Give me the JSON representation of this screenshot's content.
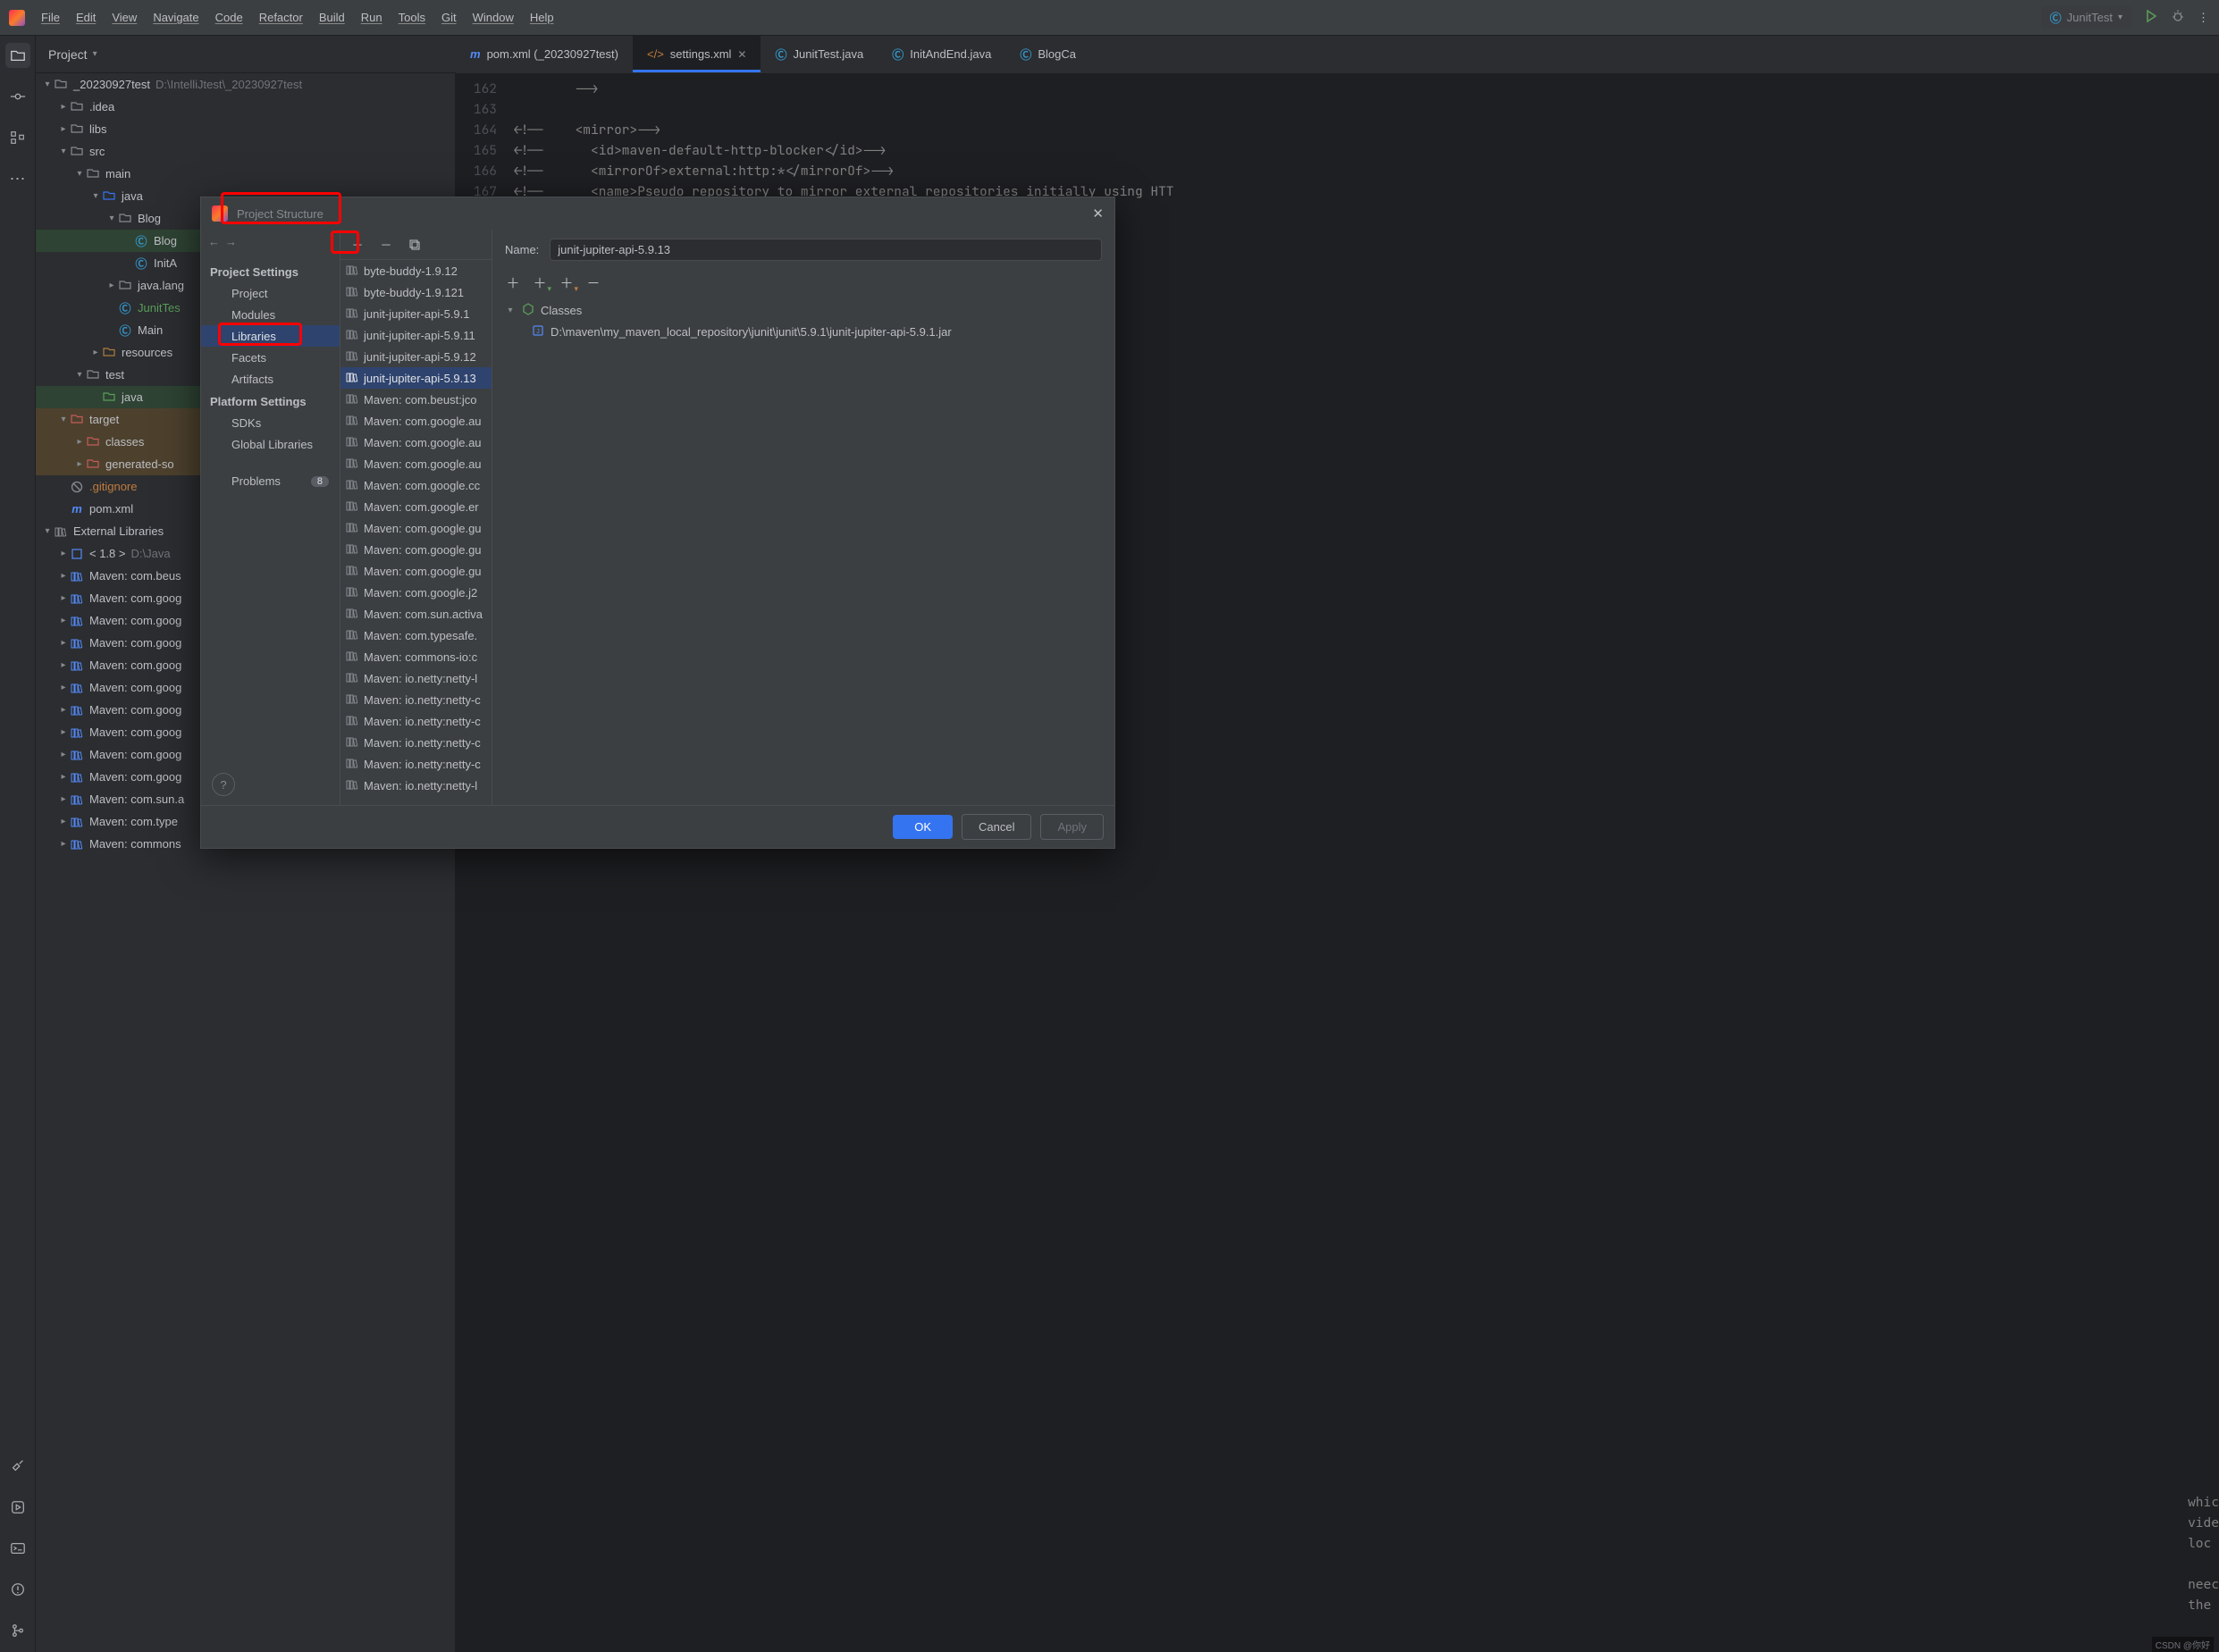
{
  "menubar": [
    "File",
    "Edit",
    "View",
    "Navigate",
    "Code",
    "Refactor",
    "Build",
    "Run",
    "Tools",
    "Git",
    "Window",
    "Help"
  ],
  "runConfig": "JunitTest",
  "projectHeader": "Project",
  "tree": {
    "root": "_20230927test",
    "rootPath": "D:\\IntelliJtest\\_20230927test",
    "idea": ".idea",
    "libs": "libs",
    "src": "src",
    "main": "main",
    "java_main": "java",
    "blog": "Blog",
    "blogfile": "Blog",
    "initfile": "InitA",
    "javalang": "java.lang",
    "junittest": "JunitTes",
    "mainclass": "Main",
    "resources": "resources",
    "test": "test",
    "java_test": "java",
    "target": "target",
    "classes": "classes",
    "generated": "generated-so",
    "gitignore": ".gitignore",
    "pomxml": "pom.xml",
    "external": "External Libraries",
    "jdk": "< 1.8 >",
    "jdkPath": "D:\\Java",
    "maven_libs": [
      "Maven: com.beus",
      "Maven: com.goog",
      "Maven: com.goog",
      "Maven: com.goog",
      "Maven: com.goog",
      "Maven: com.goog",
      "Maven: com.goog",
      "Maven: com.goog",
      "Maven: com.goog",
      "Maven: com.goog",
      "Maven: com.sun.a",
      "Maven: com.type",
      "Maven: commons"
    ]
  },
  "tabs": [
    {
      "icon": "m",
      "label": "pom.xml (_20230927test)",
      "active": false,
      "close": false
    },
    {
      "icon": "code",
      "label": "settings.xml",
      "active": true,
      "close": true
    },
    {
      "icon": "c",
      "label": "JunitTest.java",
      "active": false,
      "close": false
    },
    {
      "icon": "c",
      "label": "InitAndEnd.java",
      "active": false,
      "close": false
    },
    {
      "icon": "c",
      "label": "BlogCa",
      "active": false,
      "close": false
    }
  ],
  "code": [
    {
      "n": "162",
      "t": "        -->"
    },
    {
      "n": "163",
      "t": ""
    },
    {
      "n": "164",
      "t": "<!--    <mirror>-->"
    },
    {
      "n": "165",
      "t": "<!--      <id>maven-default-http-blocker</id>-->"
    },
    {
      "n": "166",
      "t": "<!--      <mirrorOf>external:http:*</mirrorOf>-->"
    },
    {
      "n": "167",
      "t": "<!--      <name>Pseudo repository to mirror external repositories initially using HTT"
    }
  ],
  "codeBg": [
    "whic",
    "vide",
    "loc",
    "",
    "neec",
    "the"
  ],
  "modal": {
    "title": "Project Structure",
    "sections": {
      "projectSettings": "Project Settings",
      "platformSettings": "Platform Settings"
    },
    "nav": {
      "project": "Project",
      "modules": "Modules",
      "libraries": "Libraries",
      "facets": "Facets",
      "artifacts": "Artifacts",
      "sdks": "SDKs",
      "globalLibraries": "Global Libraries",
      "problems": "Problems"
    },
    "problemsCount": "8",
    "libList": [
      "byte-buddy-1.9.12",
      "byte-buddy-1.9.121",
      "junit-jupiter-api-5.9.1",
      "junit-jupiter-api-5.9.11",
      "junit-jupiter-api-5.9.12",
      "junit-jupiter-api-5.9.13",
      "Maven: com.beust:jco",
      "Maven: com.google.au",
      "Maven: com.google.au",
      "Maven: com.google.au",
      "Maven: com.google.cc",
      "Maven: com.google.er",
      "Maven: com.google.gu",
      "Maven: com.google.gu",
      "Maven: com.google.gu",
      "Maven: com.google.j2",
      "Maven: com.sun.activa",
      "Maven: com.typesafe.",
      "Maven: commons-io:c",
      "Maven: io.netty:netty-l",
      "Maven: io.netty:netty-c",
      "Maven: io.netty:netty-c",
      "Maven: io.netty:netty-c",
      "Maven: io.netty:netty-c",
      "Maven: io.netty:netty-l"
    ],
    "selectedLibIndex": 5,
    "nameLabel": "Name:",
    "nameValue": "junit-jupiter-api-5.9.13",
    "classesLabel": "Classes",
    "jarPath": "D:\\maven\\my_maven_local_repository\\junit\\junit\\5.9.1\\junit-jupiter-api-5.9.1.jar",
    "buttons": {
      "ok": "OK",
      "cancel": "Cancel",
      "apply": "Apply"
    }
  },
  "watermark": "CSDN @你好"
}
